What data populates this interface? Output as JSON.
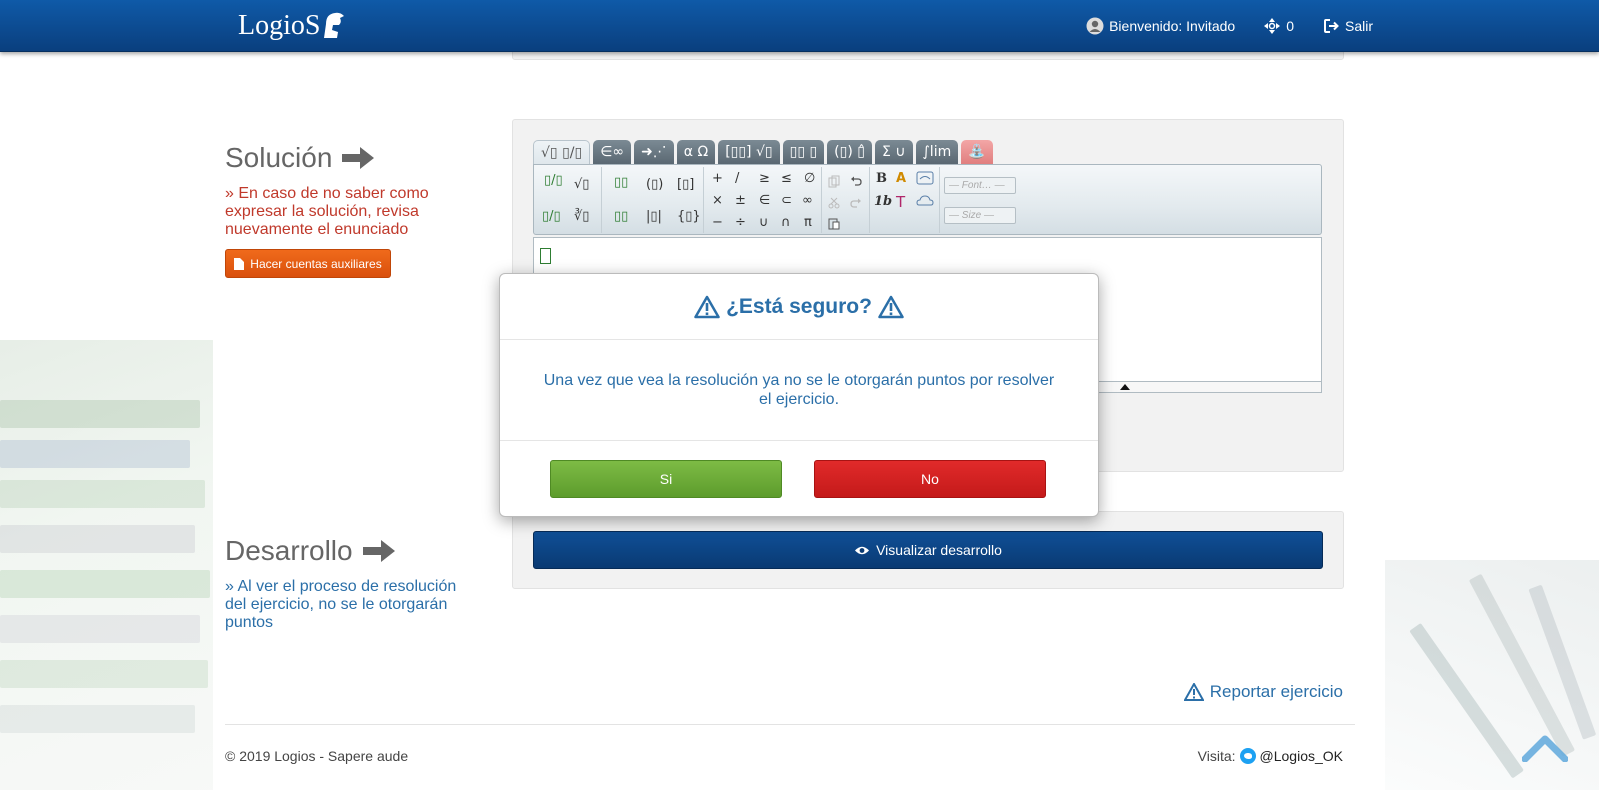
{
  "header": {
    "logo_text": "LogioS",
    "welcome": "Bienvenido: Invitado",
    "points": "0",
    "logout": "Salir"
  },
  "solucion": {
    "title": "Solución",
    "note": "» En caso de no saber como expresar la solución, revisa nuevamente el enunciado",
    "aux_button": "Hacer cuentas auxiliares"
  },
  "editor": {
    "tabs": [
      "√▯ ▯/▯",
      "∈∞",
      "➜⋰",
      "α Ω",
      "[▯▯] √▯",
      "▯▯ ▯",
      "(▯) ▯̂",
      "Σ ∪",
      "∫lim",
      "⛲"
    ],
    "font_placeholder": "— Font… —",
    "size_placeholder": "— Size —",
    "buttons": {
      "frac": "▯/▯",
      "sqrt": "√▯",
      "pow": "▯▯",
      "paren": "(▯)",
      "brack": "[▯]",
      "frac2": "▯/▯",
      "nroot": "∛▯",
      "sub": "▯▯",
      "abs": "|▯|",
      "brace": "{▯}",
      "plus": "+",
      "slash": "/",
      "geq": "≥",
      "leq": "≤",
      "empty": "∅",
      "times": "×",
      "pm": "±",
      "in": "∈",
      "subset": "⊂",
      "inf": "∞",
      "minus": "−",
      "div": "÷",
      "cup": "∪",
      "cap": "∩",
      "pi": "π",
      "bold": "B",
      "italic": "1b",
      "color": "A",
      "textmode": "T"
    }
  },
  "desarrollo": {
    "title": "Desarrollo",
    "note": "» Al ver el proceso de resolución del ejercicio, no se le otorgarán puntos",
    "view_button": "Visualizar desarrollo"
  },
  "report": "Reportar ejercicio",
  "footer": {
    "copyright": "© 2019 Logios - Sapere aude",
    "visit_label": "Visita:",
    "twitter": "@Logios_OK"
  },
  "modal": {
    "title": "¿Está seguro?",
    "message": "Una vez que vea la resolución ya no se le otorgarán puntos por resolver el ejercicio.",
    "yes": "Si",
    "no": "No"
  },
  "colors": {
    "header": "#0a4a90",
    "accent_blue": "#2b6fa8",
    "note_red": "#c0392b",
    "btn_orange": "#e85d13",
    "btn_green": "#6aab36",
    "btn_red": "#d02020"
  }
}
